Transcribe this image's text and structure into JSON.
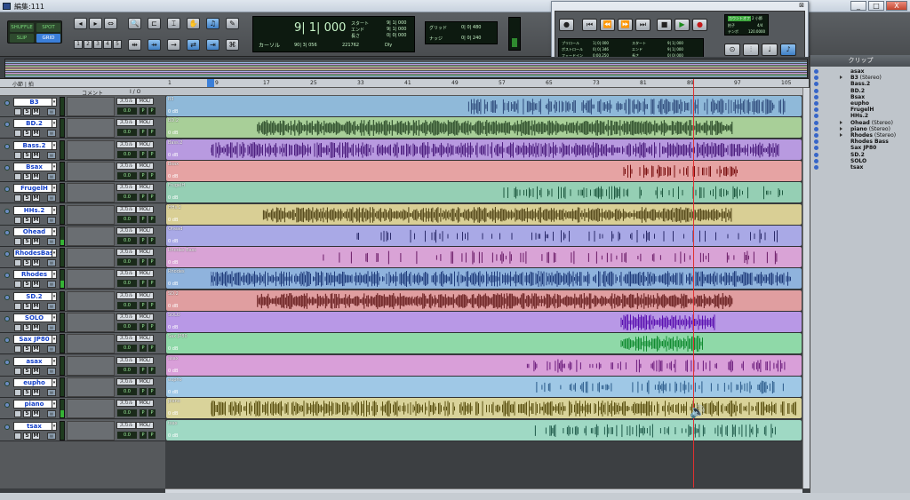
{
  "window": {
    "title": "編集:111",
    "min_label": "_",
    "max_label": "□",
    "close_label": "X"
  },
  "toolbar": {
    "modes": [
      "SHUFFLE",
      "SPOT",
      "SLIP",
      "GRID"
    ],
    "nums": [
      "1",
      "2",
      "3",
      "4",
      "5"
    ],
    "main_counter": "9| 1| 000",
    "cursor_label": "カーソル",
    "cursor_value": "90| 3| 056",
    "sample_value": "221762",
    "dly_label": "Dly",
    "start_label": "スタート",
    "start_value": "9| 1| 000",
    "end_label": "エンド",
    "end_value": "9| 1| 000",
    "length_label": "長さ",
    "length_value": "0| 0| 000",
    "grid_label": "グリッド",
    "grid_value": "0| 0| 480",
    "nudge_label": "ナッジ",
    "nudge_value": "0| 0| 240"
  },
  "transport": {
    "preroll_label": "プリロール",
    "preroll_value": "1| 0| 000",
    "postroll_label": "ポストロール",
    "postroll_value": "0| 0| 346",
    "fade_label": "フェードイン",
    "fade_value": "0:00.250",
    "start_label": "スタート",
    "start_value": "9| 1| 000",
    "end_label": "エンド",
    "end_value": "9| 1| 000",
    "length_label": "長さ",
    "length_value": "0| 0| 000",
    "tempo_label": "テンポ",
    "tempo_value": "120.0000",
    "meter_label": "拍子",
    "meter_value": "4/4",
    "count_label": "カウントオフ",
    "count_value": "2 小節"
  },
  "ruler": {
    "bar_label": "小節 | 拍",
    "marks": [
      "1",
      "9",
      "17",
      "25",
      "33",
      "41",
      "49",
      "57",
      "65",
      "73",
      "81",
      "89",
      "97",
      "105"
    ]
  },
  "header": {
    "comment": "コメント",
    "io": "I / O"
  },
  "tracks": [
    {
      "name": "B3",
      "clip": "B3",
      "color": "#8fb9d9",
      "wave": "#2e4a7a"
    },
    {
      "name": "BD.2",
      "clip": "BD.2",
      "color": "#a8cf98",
      "wave": "#1e3d1e"
    },
    {
      "name": "Bass.2",
      "clip": "Bass.2",
      "color": "#b89ae0",
      "wave": "#4c1d7e"
    },
    {
      "name": "Bsax",
      "clip": "Bsax",
      "color": "#e6a3a3",
      "wave": "#7a1010"
    },
    {
      "name": "FrugelH",
      "clip": "FrugelH",
      "color": "#95cfb4",
      "wave": "#1e5a40"
    },
    {
      "name": "HHs.2",
      "clip": "HHs.2",
      "color": "#d9cf95",
      "wave": "#4a3d10"
    },
    {
      "name": "Ohead",
      "clip": "Ohead",
      "color": "#a9a9e6",
      "wave": "#2a2a6a"
    },
    {
      "name": "RhodesBas",
      "clip": "Rhodes Bass",
      "color": "#d9a3d6",
      "wave": "#6a1a66"
    },
    {
      "name": "Rhodes",
      "clip": "Rhodes",
      "color": "#8fb3dd",
      "wave": "#1f3b7a"
    },
    {
      "name": "SD.2",
      "clip": "SD.2",
      "color": "#e09ea0",
      "wave": "#5a1010"
    },
    {
      "name": "SOLO",
      "clip": "SOLO",
      "color": "#b898e6",
      "wave": "#5a10b0"
    },
    {
      "name": "Sax JP80",
      "clip": "Sax JP80",
      "color": "#8fd9a8",
      "wave": "#108a30"
    },
    {
      "name": "asax",
      "clip": "asax",
      "color": "#d99fd9",
      "wave": "#6a1a7a"
    },
    {
      "name": "eupho",
      "clip": "eupho",
      "color": "#9fc8e6",
      "wave": "#2a5a8a"
    },
    {
      "name": "piano",
      "clip": "piano",
      "color": "#d9d39a",
      "wave": "#5a5010"
    },
    {
      "name": "tsax",
      "clip": "tsax",
      "color": "#9fd9c4",
      "wave": "#1e5a4a"
    }
  ],
  "track_ui": {
    "rec": "",
    "solo": "S",
    "mute": "M",
    "input": "スカル",
    "output": "MOL/",
    "vol": "0.0",
    "pan": "P",
    "db": "0 dB"
  },
  "clips_panel": {
    "title": "クリップ",
    "items": [
      {
        "name": "asax",
        "suffix": ""
      },
      {
        "name": "B3",
        "suffix": " (Stereo)"
      },
      {
        "name": "Bass.2",
        "suffix": ""
      },
      {
        "name": "BD.2",
        "suffix": ""
      },
      {
        "name": "Bsax",
        "suffix": ""
      },
      {
        "name": "eupho",
        "suffix": ""
      },
      {
        "name": "FrugelH",
        "suffix": ""
      },
      {
        "name": "HHs.2",
        "suffix": ""
      },
      {
        "name": "Ohead",
        "suffix": " (Stereo)"
      },
      {
        "name": "piano",
        "suffix": " (Stereo)"
      },
      {
        "name": "Rhodes",
        "suffix": " (Stereo)"
      },
      {
        "name": "Rhodes Bass",
        "suffix": ""
      },
      {
        "name": "Sax JP80",
        "suffix": ""
      },
      {
        "name": "SD.2",
        "suffix": ""
      },
      {
        "name": "SOLO",
        "suffix": ""
      },
      {
        "name": "tsax",
        "suffix": ""
      }
    ]
  }
}
